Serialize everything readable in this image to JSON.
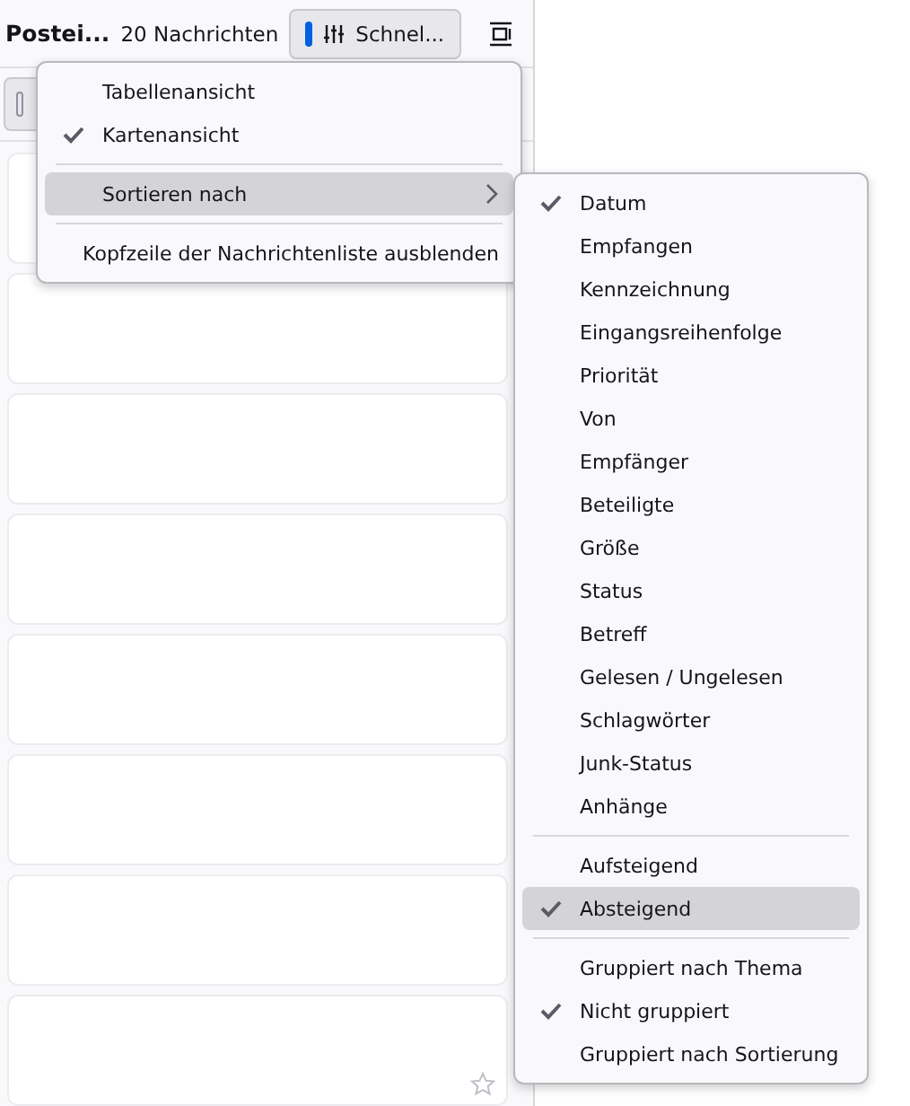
{
  "header": {
    "folder_name": "Postei...",
    "message_count": "20 Nachrichten",
    "quick_filter_button": "Schnel..."
  },
  "message_list": {
    "cards": [
      {
        "star_shown": false
      },
      {
        "star_shown": false
      },
      {
        "star_shown": false
      },
      {
        "star_shown": false
      },
      {
        "star_shown": false
      },
      {
        "star_shown": false
      },
      {
        "star_shown": false
      },
      {
        "star_shown": true
      }
    ]
  },
  "context_menu": {
    "items": [
      {
        "kind": "item",
        "label": "Tabellenansicht",
        "checked": false,
        "selected": false
      },
      {
        "kind": "item",
        "label": "Kartenansicht",
        "checked": true,
        "selected": false
      },
      {
        "kind": "separator"
      },
      {
        "kind": "submenu",
        "label": "Sortieren nach",
        "checked": false,
        "selected": true
      },
      {
        "kind": "separator"
      },
      {
        "kind": "item",
        "label": "Kopfzeile der Nachrichtenliste ausblenden",
        "checked": false,
        "selected": false
      }
    ]
  },
  "sort_submenu": {
    "items": [
      {
        "kind": "item",
        "label": "Datum",
        "checked": true,
        "selected": false
      },
      {
        "kind": "item",
        "label": "Empfangen",
        "checked": false,
        "selected": false
      },
      {
        "kind": "item",
        "label": "Kennzeichnung",
        "checked": false,
        "selected": false
      },
      {
        "kind": "item",
        "label": "Eingangsreihenfolge",
        "checked": false,
        "selected": false
      },
      {
        "kind": "item",
        "label": "Priorität",
        "checked": false,
        "selected": false
      },
      {
        "kind": "item",
        "label": "Von",
        "checked": false,
        "selected": false
      },
      {
        "kind": "item",
        "label": "Empfänger",
        "checked": false,
        "selected": false
      },
      {
        "kind": "item",
        "label": "Beteiligte",
        "checked": false,
        "selected": false
      },
      {
        "kind": "item",
        "label": "Größe",
        "checked": false,
        "selected": false
      },
      {
        "kind": "item",
        "label": "Status",
        "checked": false,
        "selected": false
      },
      {
        "kind": "item",
        "label": "Betreff",
        "checked": false,
        "selected": false
      },
      {
        "kind": "item",
        "label": "Gelesen / Ungelesen",
        "checked": false,
        "selected": false
      },
      {
        "kind": "item",
        "label": "Schlagwörter",
        "checked": false,
        "selected": false
      },
      {
        "kind": "item",
        "label": "Junk-Status",
        "checked": false,
        "selected": false
      },
      {
        "kind": "item",
        "label": "Anhänge",
        "checked": false,
        "selected": false
      },
      {
        "kind": "separator"
      },
      {
        "kind": "item",
        "label": "Aufsteigend",
        "checked": false,
        "selected": false
      },
      {
        "kind": "item",
        "label": "Absteigend",
        "checked": true,
        "selected": true
      },
      {
        "kind": "separator"
      },
      {
        "kind": "item",
        "label": "Gruppiert nach Thema",
        "checked": false,
        "selected": false
      },
      {
        "kind": "item",
        "label": "Nicht gruppiert",
        "checked": true,
        "selected": false
      },
      {
        "kind": "item",
        "label": "Gruppiert nach Sortierung",
        "checked": false,
        "selected": false
      }
    ]
  }
}
